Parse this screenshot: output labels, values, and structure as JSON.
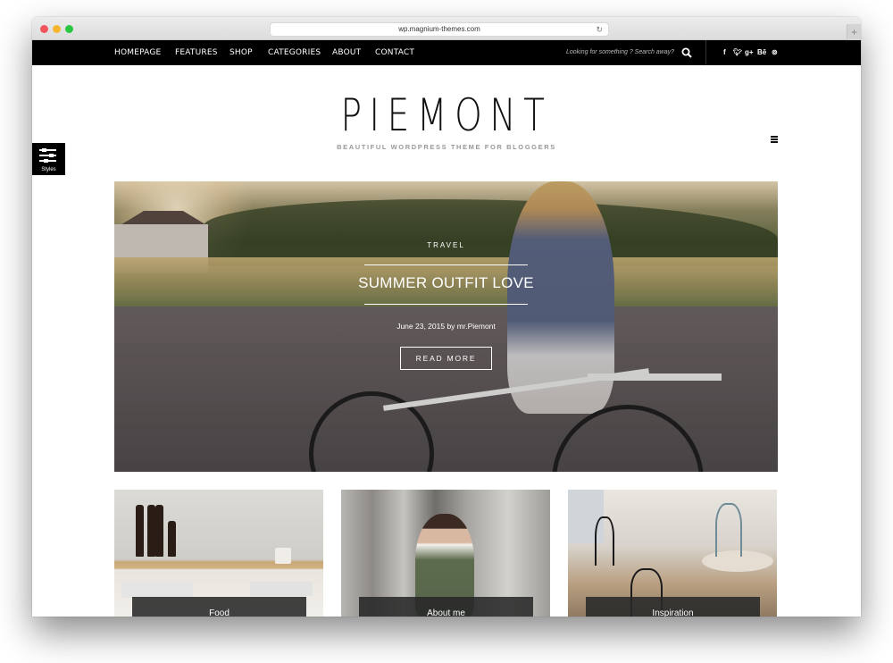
{
  "browser": {
    "url": "wp.magnium-themes.com",
    "reload_icon": "reload-icon",
    "new_tab_label": "+"
  },
  "nav": {
    "items": [
      {
        "label": "HOMEPAGE"
      },
      {
        "label": "FEATURES"
      },
      {
        "label": "SHOP"
      },
      {
        "label": "CATEGORIES"
      },
      {
        "label": "ABOUT"
      },
      {
        "label": "CONTACT"
      }
    ],
    "search_placeholder": "Looking for something ? Search away?",
    "social": [
      {
        "name": "facebook",
        "glyph": "f"
      },
      {
        "name": "twitter",
        "glyph": "t"
      },
      {
        "name": "google-plus",
        "glyph": "g+"
      },
      {
        "name": "behance",
        "glyph": "Bē"
      },
      {
        "name": "pinterest",
        "glyph": "p"
      }
    ]
  },
  "site": {
    "logo": "PIEMONT",
    "tagline": "BEAUTIFUL  WORDPRESS THEME FOR BLOGGERS",
    "styles_label": "Styles"
  },
  "hero": {
    "category": "TRAVEL",
    "title": "SUMMER OUTFIT LOVE",
    "meta": "June 23, 2015 by mr.Piemont",
    "button": "READ MORE"
  },
  "cards": [
    {
      "caption": "Food"
    },
    {
      "caption": "About me"
    },
    {
      "caption": "Inspiration"
    }
  ],
  "colors": {
    "navbar_bg": "#000000",
    "page_bg": "#ffffff",
    "caption_bg": "#282828",
    "text_light": "#ffffff"
  }
}
